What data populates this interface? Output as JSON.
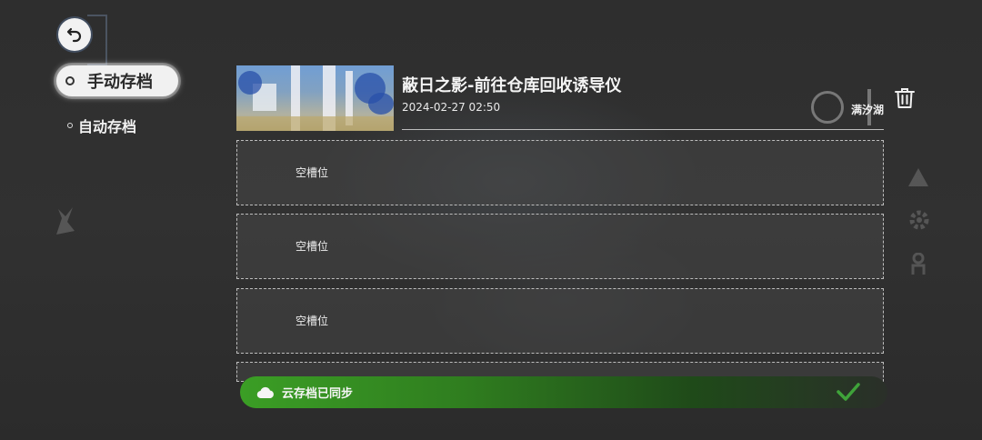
{
  "tabs": {
    "manual_label": "手动存档",
    "auto_label": "自动存档"
  },
  "saves": [
    {
      "title": "蔽日之影-前往仓库回收诱导仪",
      "datetime": "2024-02-27 02:50",
      "location": "满汐湖"
    }
  ],
  "empty_slots": [
    "空槽位",
    "空槽位",
    "空槽位"
  ],
  "cloud_sync": {
    "label": "云存档已同步",
    "color": "#3b9e25"
  },
  "icons": {
    "back": "back-arrow-icon",
    "delete": "trash-icon",
    "cloud": "cloud-icon",
    "check": "check-icon"
  }
}
